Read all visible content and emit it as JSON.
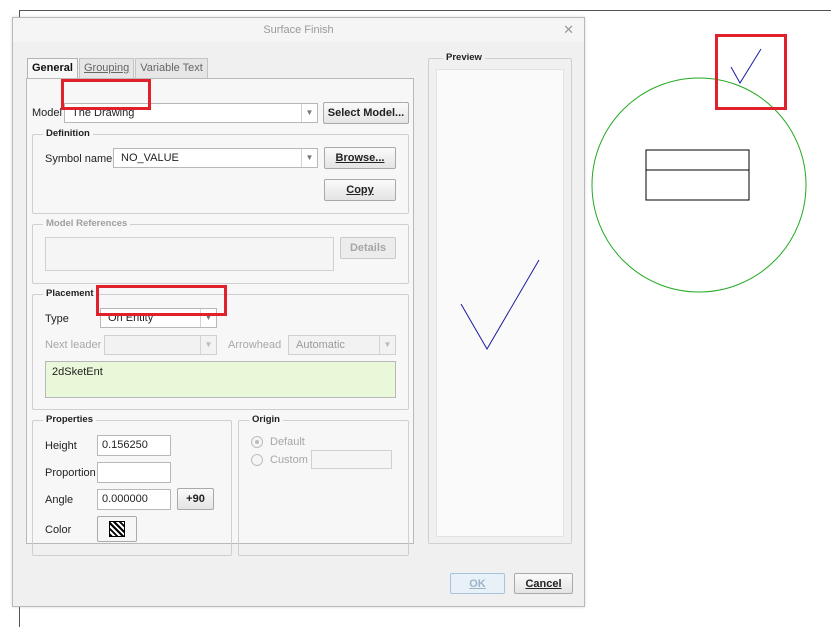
{
  "dialog": {
    "title": "Surface Finish",
    "close_icon": "close-icon"
  },
  "tabs": [
    {
      "label": "General",
      "active": true
    },
    {
      "label": "Grouping",
      "active": false
    },
    {
      "label": "Variable Text",
      "active": false
    }
  ],
  "model": {
    "label": "Model",
    "value": "The Drawing",
    "select_button": "Select Model..."
  },
  "definition": {
    "title": "Definition",
    "symbol_label": "Symbol name",
    "symbol_value": "NO_VALUE",
    "browse_button": "Browse...",
    "copy_button": "Copy"
  },
  "model_references": {
    "title": "Model References",
    "details_button": "Details"
  },
  "placement": {
    "title": "Placement",
    "type_label": "Type",
    "type_value": "On Entity",
    "next_leader_label": "Next leader",
    "arrowhead_label": "Arrowhead",
    "arrowhead_value": "Automatic",
    "entity": "2dSketEnt"
  },
  "properties": {
    "title": "Properties",
    "height_label": "Height",
    "height_value": "0.156250",
    "proportion_label": "Proportion",
    "proportion_value": "",
    "angle_label": "Angle",
    "angle_value": "0.000000",
    "plus90_button": "+90",
    "color_label": "Color"
  },
  "origin": {
    "title": "Origin",
    "default_label": "Default",
    "custom_label": "Custom"
  },
  "preview": {
    "title": "Preview"
  },
  "footer": {
    "ok_button": "OK",
    "cancel_button": "Cancel"
  },
  "colors": {
    "highlight": "#e0202a",
    "checkmark": "#1a1aa0",
    "circle": "#22aa22",
    "entity_box_bg": "#e9f8d9"
  }
}
